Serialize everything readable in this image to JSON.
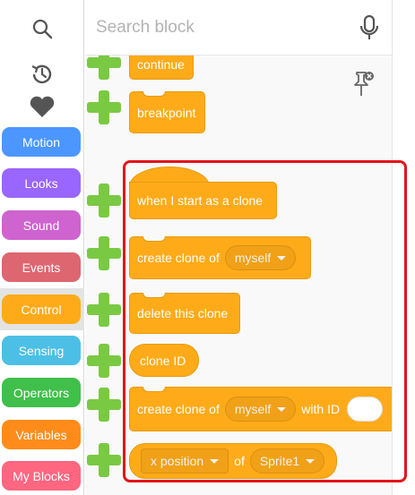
{
  "search": {
    "placeholder": "Search block"
  },
  "tools": {
    "search_icon": "search-icon",
    "history_icon": "history-icon",
    "favorites_icon": "heart-icon",
    "mic_icon": "microphone-icon",
    "pin_icon": "unpin-icon"
  },
  "categories": [
    {
      "label": "Motion",
      "color": "#4c97ff"
    },
    {
      "label": "Looks",
      "color": "#9966ff"
    },
    {
      "label": "Sound",
      "color": "#cf63cf"
    },
    {
      "label": "Events",
      "color": "#de6670"
    },
    {
      "label": "Control",
      "color": "#ffab19",
      "selected": true
    },
    {
      "label": "Sensing",
      "color": "#4cbfe6"
    },
    {
      "label": "Operators",
      "color": "#40bf4a"
    },
    {
      "label": "Variables",
      "color": "#ff8c1a"
    },
    {
      "label": "My Blocks",
      "color": "#ff6680"
    }
  ],
  "blocks": {
    "continue": "continue",
    "breakpoint": "breakpoint",
    "when_clone": "when I start as a clone",
    "create_clone": {
      "text": "create clone of",
      "option": "myself"
    },
    "delete_clone": "delete this clone",
    "clone_id": "clone ID",
    "create_clone_id": {
      "text": "create clone of",
      "option": "myself",
      "suffix": "with ID"
    },
    "sensing_of": {
      "property": "x position",
      "of": "of",
      "target": "Sprite1"
    }
  },
  "colors": {
    "control_block": "#ffab19",
    "add_plus": "#7ac943",
    "highlight_border": "#e3141b"
  }
}
